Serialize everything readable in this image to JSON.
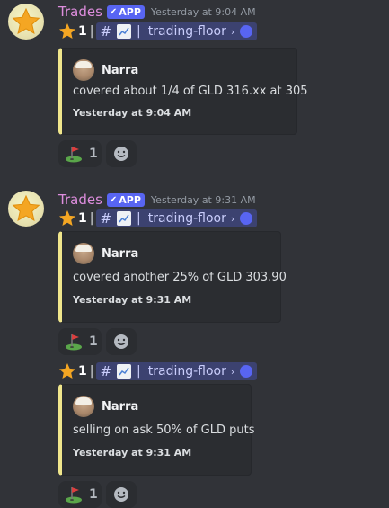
{
  "messages": [
    {
      "username": "Trades",
      "badge": "APP",
      "badge_check": "✔",
      "timestamp": "Yesterday at 9:04 AM",
      "show_header": true,
      "forward_count": "1",
      "pipe": "|",
      "channel": {
        "hash": "#",
        "sep": "|",
        "name": "trading-floor",
        "chevron": "›"
      },
      "embed": {
        "author": "Narra",
        "description": "covered about 1/4 of GLD 316.xx at 305",
        "footer": "Yesterday at 9:04 AM"
      },
      "reaction": {
        "emoji": "golf-flag",
        "count": "1"
      }
    },
    {
      "username": "Trades",
      "badge": "APP",
      "badge_check": "✔",
      "timestamp": "Yesterday at 9:31 AM",
      "show_header": true,
      "forward_count": "1",
      "pipe": "|",
      "channel": {
        "hash": "#",
        "sep": "|",
        "name": "trading-floor",
        "chevron": "›"
      },
      "embed": {
        "author": "Narra",
        "description": "covered another 25% of GLD 303.90",
        "footer": "Yesterday at 9:31 AM"
      },
      "reaction": {
        "emoji": "golf-flag",
        "count": "1"
      }
    },
    {
      "show_header": false,
      "forward_count": "1",
      "pipe": "|",
      "channel": {
        "hash": "#",
        "sep": "|",
        "name": "trading-floor",
        "chevron": "›"
      },
      "embed": {
        "author": "Narra",
        "description": "selling on ask 50% of GLD puts",
        "footer": "Yesterday at 9:31 AM"
      },
      "reaction": {
        "emoji": "golf-flag",
        "count": "1"
      }
    }
  ],
  "colors": {
    "background": "#313338",
    "embed_accent": "#f0e68c",
    "username": "#dd8ddd",
    "badge": "#5865f2",
    "channel_mention_bg": "#3c4270"
  }
}
